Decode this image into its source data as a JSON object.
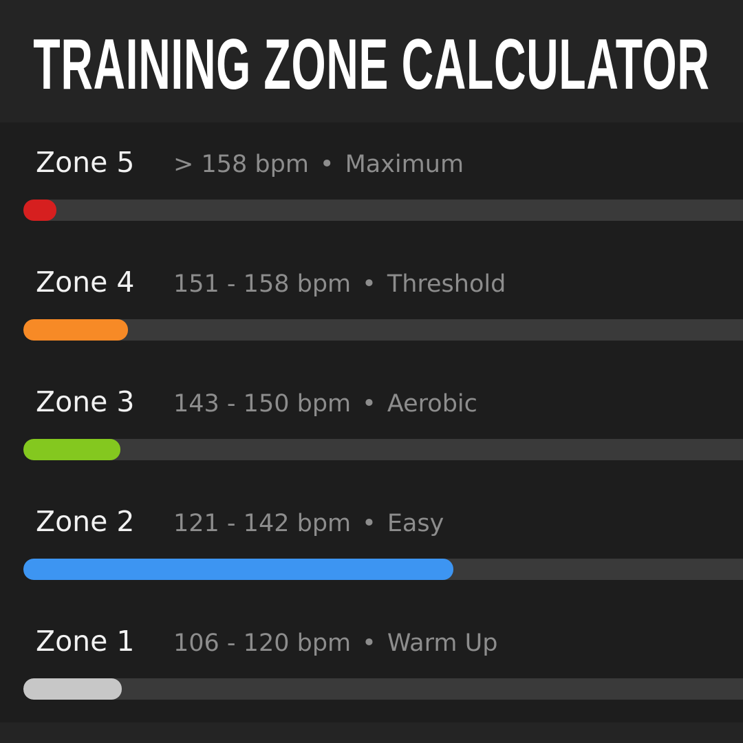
{
  "title": "TRAINING ZONE CALCULATOR",
  "zones": [
    {
      "name": "Zone 5",
      "range": "> 158 bpm",
      "label": "Maximum",
      "fill": 0.045,
      "color": "#d61f1f"
    },
    {
      "name": "Zone 4",
      "range": "151 - 158 bpm",
      "label": "Threshold",
      "fill": 0.143,
      "color": "#f78a26"
    },
    {
      "name": "Zone 3",
      "range": "143 - 150 bpm",
      "label": "Aerobic",
      "fill": 0.133,
      "color": "#84c81f"
    },
    {
      "name": "Zone 2",
      "range": "121 - 142 bpm",
      "label": "Easy",
      "fill": 0.59,
      "color": "#3d95f2"
    },
    {
      "name": "Zone 1",
      "range": "106 - 120 bpm",
      "label": "Warm Up",
      "fill": 0.135,
      "color": "#c7c7c7"
    }
  ],
  "separator": "•",
  "track_color": "#3a3a3a"
}
